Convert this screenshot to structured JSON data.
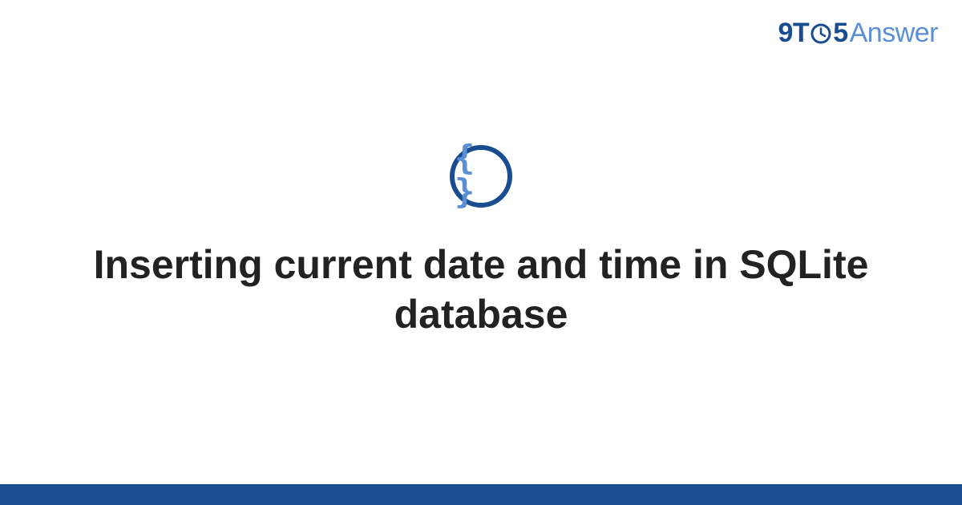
{
  "brand": {
    "nine": "9",
    "t": "T",
    "five": "5",
    "answer": "Answer"
  },
  "badge": {
    "glyph": "{ }"
  },
  "page": {
    "title": "Inserting current date and time in SQLite database"
  },
  "colors": {
    "primary": "#1a4d8f",
    "accent": "#5a8fd6"
  }
}
